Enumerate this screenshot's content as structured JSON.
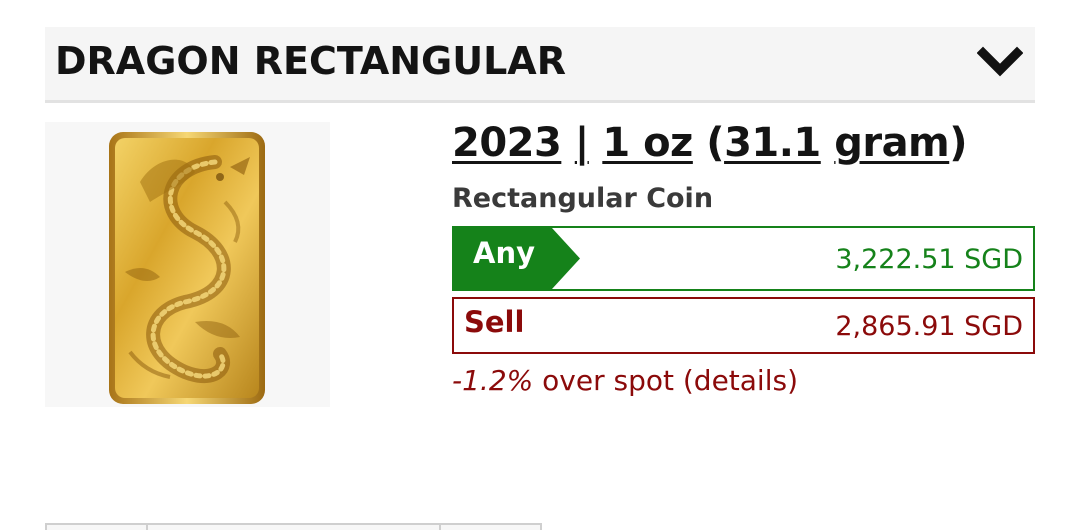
{
  "header": {
    "title": "DRAGON RECTANGULAR",
    "toggle_icon": "chevron-down-icon"
  },
  "product": {
    "image_icon": "gold-dragon-rectangular-coin",
    "year": "2023",
    "separator": "|",
    "weight": "1 oz",
    "grams": "31.1",
    "gram_unit": "gram",
    "type": "Rectangular Coin"
  },
  "pricing": {
    "buy_label": "Any",
    "buy_price": "3,222.51 SGD",
    "sell_label": "Sell",
    "sell_price": "2,865.91 SGD",
    "spot_percent": "-1.2%",
    "spot_text": "over spot",
    "details_link": "(details)"
  },
  "colors": {
    "buy_green": "#15821a",
    "sell_red": "#8b0a0a",
    "header_bg": "#f5f5f5",
    "gold": "#d4a72c"
  }
}
